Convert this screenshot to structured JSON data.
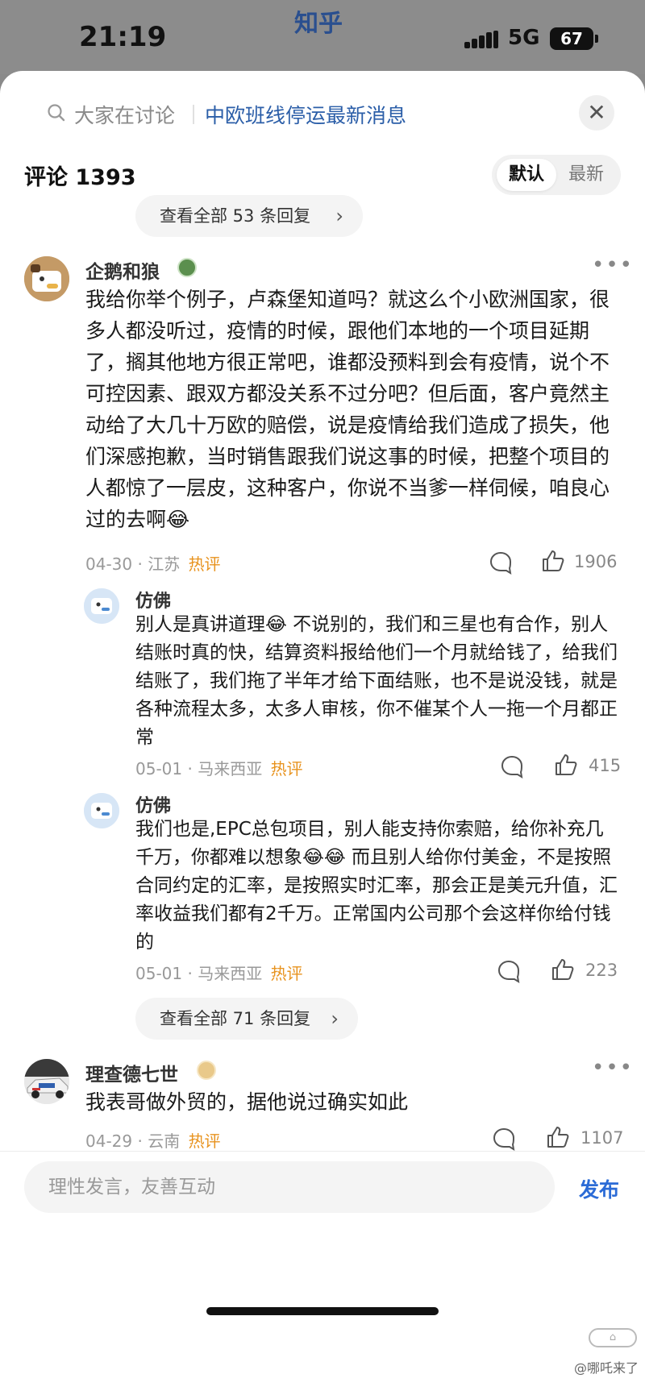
{
  "status_bar": {
    "time": "21:19",
    "app_name": "知乎",
    "network": "5G",
    "battery": "67"
  },
  "header": {
    "search_hint": "大家在讨论",
    "hot_topic": "中欧班线停运最新消息",
    "comment_count_label": "评论 1393",
    "sort_options": [
      "默认",
      "最新"
    ]
  },
  "top_more_replies": "查看全部 53 条回复",
  "comments": [
    {
      "user": "企鹅和狼",
      "text": "我给你举个例子，卢森堡知道吗？就这么个小欧洲国家，很多人都没听过，疫情的时候，跟他们本地的一个项目延期了，搁其他地方很正常吧，谁都没预料到会有疫情，说个不可控因素、跟双方都没关系不过分吧？但后面，客户竟然主动给了大几十万欧的赔偿，说是疫情给我们造成了损失，他们深感抱歉，当时销售跟我们说这事的时候，把整个项目的人都惊了一层皮，这种客户，你说不当爹一样伺候，咱良心过的去啊😂",
      "date": "04-30",
      "location": "江苏",
      "hot": "热评",
      "likes": "1906",
      "replies": [
        {
          "user": "仿佛",
          "text": "别人是真讲道理😂 不说别的，我们和三星也有合作，别人结账时真的快，结算资料报给他们一个月就给钱了，给我们结账了，我们拖了半年才给下面结账，也不是说没钱，就是各种流程太多，太多人审核，你不催某个人一拖一个月都正常",
          "date": "05-01",
          "location": "马来西亚",
          "hot": "热评",
          "likes": "415"
        },
        {
          "user": "仿佛",
          "text": "我们也是,EPC总包项目，别人能支持你索赔，给你补充几千万，你都难以想象😂😂 而且别人给你付美金，不是按照合同约定的汇率，是按照实时汇率，那会正是美元升值，汇率收益我们都有2千万。正常国内公司那个会这样你给付钱的",
          "date": "05-01",
          "location": "马来西亚",
          "hot": "热评",
          "likes": "223"
        }
      ],
      "more_replies": "查看全部 71 条回复"
    },
    {
      "user": "理查德七世",
      "text": "我表哥做外贸的，据他说过确实如此",
      "date": "04-29",
      "location": "云南",
      "hot": "热评",
      "likes": "1107"
    }
  ],
  "input": {
    "placeholder": "理性发言，友善互动",
    "publish": "发布"
  },
  "watermark": "@哪吒来了"
}
